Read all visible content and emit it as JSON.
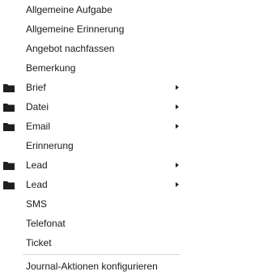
{
  "menu": {
    "items": [
      {
        "label": "Allgemeine Aufgabe",
        "folder": false,
        "submenu": false
      },
      {
        "label": "Allgemeine Erinnerung",
        "folder": false,
        "submenu": false
      },
      {
        "label": "Angebot nachfassen",
        "folder": false,
        "submenu": false
      },
      {
        "label": "Bemerkung",
        "folder": false,
        "submenu": false
      },
      {
        "label": "Brief",
        "folder": true,
        "submenu": true
      },
      {
        "label": "Datei",
        "folder": true,
        "submenu": true
      },
      {
        "label": "Email",
        "folder": true,
        "submenu": true
      },
      {
        "label": "Erinnerung",
        "folder": false,
        "submenu": false
      },
      {
        "label": "Lead",
        "folder": true,
        "submenu": true
      },
      {
        "label": "Lead",
        "folder": true,
        "submenu": true
      },
      {
        "label": "SMS",
        "folder": false,
        "submenu": false
      },
      {
        "label": "Telefonat",
        "folder": false,
        "submenu": false
      },
      {
        "label": "Ticket",
        "folder": false,
        "submenu": false
      }
    ],
    "footer_label": "Journal-Aktionen konfigurieren"
  },
  "colors": {
    "folder_icon": "#1f1f1f",
    "text": "#1a1a1a",
    "separator": "#d6d6d6"
  }
}
